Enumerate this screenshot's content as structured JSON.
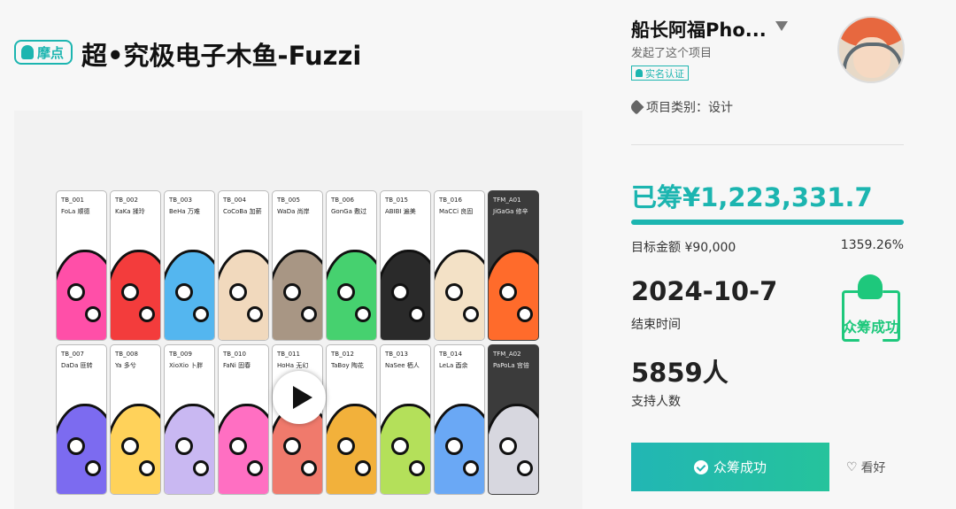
{
  "header": {
    "logo_text": "摩点",
    "title": "超•究极电子木鱼-Fuzzi"
  },
  "media": {
    "cards": [
      {
        "code": "TB_001",
        "name": "FoLa 顺德",
        "color": "#ff4fa8"
      },
      {
        "code": "TB_002",
        "name": "KaKa 揉玲",
        "color": "#f33c3c"
      },
      {
        "code": "TB_003",
        "name": "BeHa 万难",
        "color": "#54b6ef"
      },
      {
        "code": "TB_004",
        "name": "CoCoBa 加薪",
        "color": "#f1d9bd"
      },
      {
        "code": "TB_005",
        "name": "WaDa 尚岸",
        "color": "#a89684"
      },
      {
        "code": "TB_006",
        "name": "GonGa 敷过",
        "color": "#46d16f"
      },
      {
        "code": "TB_015",
        "name": "ABIBI 遍美",
        "color": "#2a2a2a"
      },
      {
        "code": "TB_016",
        "name": "MaCCi 良固",
        "color": "#f3e1c6"
      },
      {
        "code": "TFM_A01",
        "name": "JiGaGa 修辛",
        "color": "#ff6b2b",
        "dark": true
      },
      {
        "code": "TB_007",
        "name": "DaDa 匪转",
        "color": "#7c6bf0"
      },
      {
        "code": "TB_008",
        "name": "Ya 多兮",
        "color": "#ffd25a"
      },
      {
        "code": "TB_009",
        "name": "XioXio 卜胖",
        "color": "#c9b8f2"
      },
      {
        "code": "TB_010",
        "name": "FaNi 固春",
        "color": "#ff6fc2"
      },
      {
        "code": "TB_011",
        "name": "HoHa 无幻",
        "color": "#f07a6c"
      },
      {
        "code": "TB_012",
        "name": "TaBoy 陶花",
        "color": "#f2b13b"
      },
      {
        "code": "TB_013",
        "name": "NaSee 栖人",
        "color": "#b4e05a"
      },
      {
        "code": "TB_014",
        "name": "LeLa 酉余",
        "color": "#6aa8f5"
      },
      {
        "code": "TFM_A02",
        "name": "PaPoLa 宫倍",
        "color": "#d7d7df",
        "dark": true
      }
    ]
  },
  "creator": {
    "name": "船长阿福Pho...",
    "launched": "发起了这个项目",
    "verified": "实名认证"
  },
  "category": "项目类别：设计",
  "stats": {
    "raised": "已筹¥1,223,331.7",
    "progress_fraction": 1.0,
    "goal": "目标金额 ¥90,000",
    "percent": "1359.26%",
    "end_date": "2024-10-7",
    "end_date_label": "结束时间",
    "backers": "5859人",
    "backers_label": "支持人数",
    "stamp": "众筹成功"
  },
  "actions": {
    "success_label": "众筹成功",
    "like_label": "看好"
  },
  "colors": {
    "accent": "#1cb5b0",
    "success": "#1ec87c"
  }
}
